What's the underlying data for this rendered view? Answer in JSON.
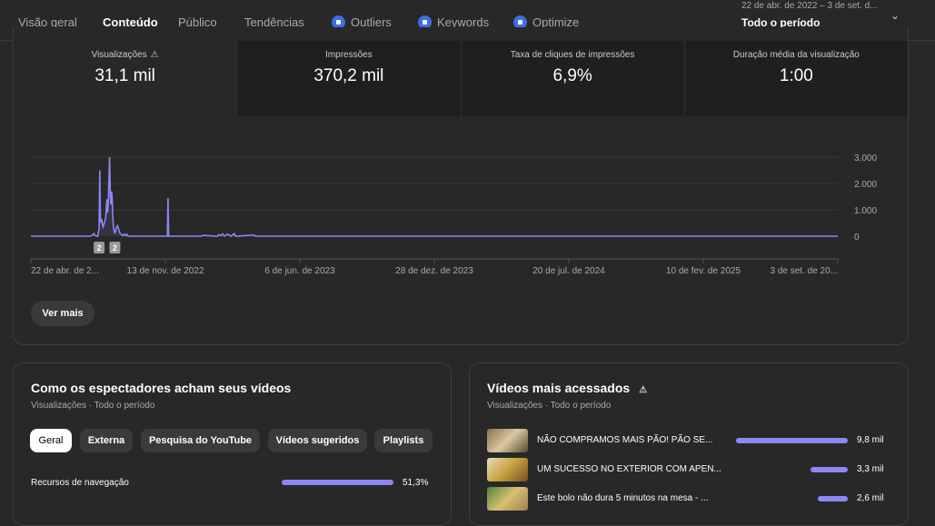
{
  "nav": {
    "tabs": [
      {
        "label": "Visão geral"
      },
      {
        "label": "Conteúdo",
        "active": true
      },
      {
        "label": "Público"
      },
      {
        "label": "Tendências"
      },
      {
        "label": "Outliers",
        "icon": "extension-icon"
      },
      {
        "label": "Keywords",
        "icon": "extension-icon"
      },
      {
        "label": "Optimize",
        "icon": "extension-icon"
      }
    ],
    "period": {
      "range": "22 de abr. de 2022 – 3 de set. d...",
      "name": "Todo o período"
    }
  },
  "metrics": [
    {
      "label": "Visualizações",
      "value": "31,1 mil",
      "warning": "⚠"
    },
    {
      "label": "Impressões",
      "value": "370,2 mil"
    },
    {
      "label": "Taxa de cliques de impressões",
      "value": "6,9%"
    },
    {
      "label": "Duração média da visualização",
      "value": "1:00"
    }
  ],
  "chart_data": {
    "type": "line",
    "series": [
      {
        "name": "Visualizações",
        "points": [
          [
            0,
            0
          ],
          [
            90,
            0
          ],
          [
            94,
            40
          ],
          [
            96,
            100
          ],
          [
            98,
            20
          ],
          [
            102,
            0
          ],
          [
            104,
            300
          ],
          [
            105,
            2500
          ],
          [
            106,
            700
          ],
          [
            107,
            500
          ],
          [
            108,
            650
          ],
          [
            109,
            450
          ],
          [
            110,
            350
          ],
          [
            112,
            500
          ],
          [
            114,
            700
          ],
          [
            116,
            1400
          ],
          [
            117,
            900
          ],
          [
            118,
            1300
          ],
          [
            120,
            3000
          ],
          [
            121,
            1500
          ],
          [
            122,
            1200
          ],
          [
            123,
            1700
          ],
          [
            124,
            1400
          ],
          [
            125,
            700
          ],
          [
            126,
            300
          ],
          [
            128,
            100
          ],
          [
            130,
            300
          ],
          [
            132,
            400
          ],
          [
            134,
            250
          ],
          [
            136,
            100
          ],
          [
            138,
            60
          ],
          [
            140,
            20
          ],
          [
            142,
            80
          ],
          [
            144,
            20
          ],
          [
            146,
            80
          ],
          [
            148,
            0
          ],
          [
            208,
            0
          ],
          [
            209,
            1450
          ],
          [
            210,
            0
          ],
          [
            260,
            0
          ],
          [
            262,
            30
          ],
          [
            285,
            0
          ],
          [
            286,
            60
          ],
          [
            290,
            20
          ],
          [
            292,
            90
          ],
          [
            295,
            0
          ],
          [
            300,
            80
          ],
          [
            305,
            0
          ],
          [
            310,
            100
          ],
          [
            312,
            0
          ],
          [
            340,
            40
          ],
          [
            342,
            0
          ],
          [
            1230,
            0
          ]
        ]
      }
    ],
    "x_ticks": [
      "22 de abr. de 2...",
      "13 de nov. de 2022",
      "6 de jun. de 2023",
      "28 de dez. de 2023",
      "20 de jul. de 2024",
      "10 de fev. de 2025",
      "3 de set. de 20..."
    ],
    "y_ticks": [
      "3.000",
      "2.000",
      "1.000",
      "0"
    ],
    "ylim": [
      0,
      3000
    ],
    "x_days": 1230,
    "markers": [
      {
        "day": 104,
        "label": "2"
      },
      {
        "day": 128,
        "label": "2"
      }
    ],
    "grid": true
  },
  "ver_mais": "Ver mais",
  "traffic": {
    "title": "Como os espectadores acham seus vídeos",
    "subtitle": "Visualizações · Todo o período",
    "chips": [
      "Geral",
      "Externa",
      "Pesquisa do YouTube",
      "Vídeos sugeridos",
      "Playlists"
    ],
    "rows": [
      {
        "label": "Recursos de navegação",
        "value": "51,3%",
        "pct": 51.3
      }
    ]
  },
  "top": {
    "title": "Vídeos mais acessados",
    "warning": "⚠",
    "subtitle": "Visualizações · Todo o período",
    "rows": [
      {
        "title": "NÃO COMPRAMOS MAIS PÃO! PÃO SE...",
        "value": "9,8 mil",
        "views": 9.8
      },
      {
        "title": "UM SUCESSO NO EXTERIOR COM APEN...",
        "value": "3,3 mil",
        "views": 3.3
      },
      {
        "title": "Este bolo não dura 5 minutos na mesa - ...",
        "value": "2,6 mil",
        "views": 2.6
      }
    ]
  },
  "colors": {
    "accent": "#8c87f5"
  }
}
